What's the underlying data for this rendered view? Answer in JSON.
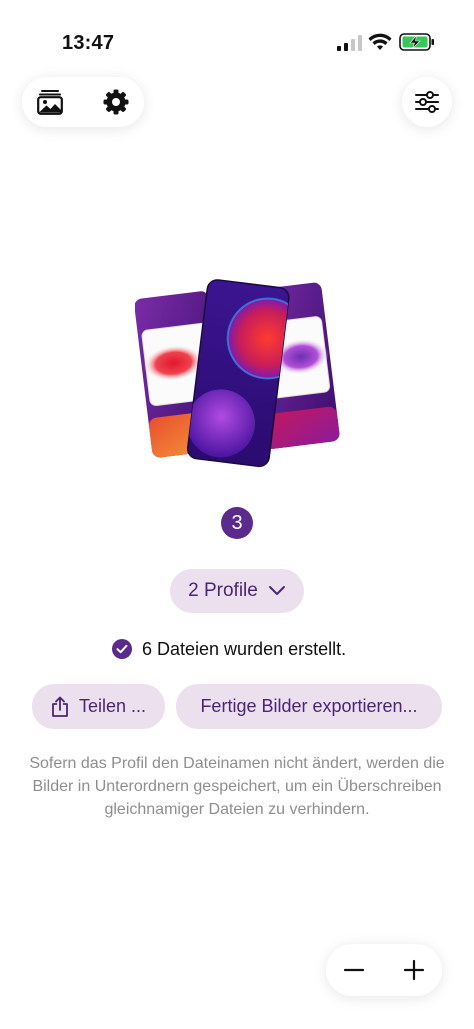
{
  "status_bar": {
    "time": "13:47",
    "icons": [
      "signal-icon",
      "wifi-icon",
      "battery-charging-icon"
    ]
  },
  "toolbar": {
    "left_icons": [
      "gallery-icon",
      "gear-icon"
    ],
    "right_icon": "sliders-icon"
  },
  "illustration": {
    "icon": "wallpaper-cards-illustration"
  },
  "main": {
    "count": "3",
    "profile_select": "2 Profile",
    "status_text": "6 Dateien wurden erstellt.",
    "share_label": "Teilen ...",
    "export_label": "Fertige Bilder exportieren...",
    "info_text": "Sofern das Profil den Dateinamen nicht ändert, werden die Bilder in Unterordnern gespeichert, um ein Überschreiben gleichnamiger Dateien zu verhindern."
  },
  "zoom": {
    "icons": [
      "minus-icon",
      "plus-icon"
    ]
  },
  "colors": {
    "accent": "#5a2a8c",
    "button_bg": "#ece0ef",
    "button_text": "#4d2377",
    "info_text": "#8e8e8e"
  }
}
